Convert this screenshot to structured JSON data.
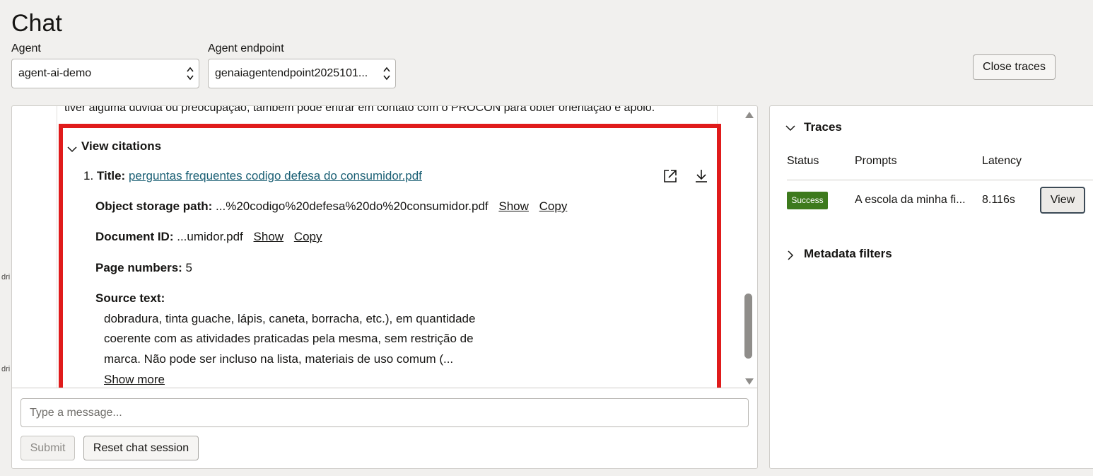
{
  "header": {
    "title": "Chat",
    "agent_label": "Agent",
    "agent_value": "agent-ai-demo",
    "endpoint_label": "Agent endpoint",
    "endpoint_value": "genaiagentendpoint2025101...",
    "close_traces_label": "Close traces"
  },
  "left_clip": [
    "dri",
    "dri"
  ],
  "chat": {
    "previous_text": "tiver alguma dúvida ou preocupação, também pode entrar em contato com o PROCON para obter orientação e apoio.",
    "citations": {
      "toggle_label": "View citations",
      "items": [
        {
          "index": "1.",
          "title_label": "Title:",
          "title_link": "perguntas frequentes codigo defesa do consumidor.pdf",
          "path_label": "Object storage path:",
          "path_value": "...%20codigo%20defesa%20do%20consumidor.pdf",
          "doc_id_label": "Document ID:",
          "doc_id_value": "...umidor.pdf",
          "show_label": "Show",
          "copy_label": "Copy",
          "page_label": "Page numbers:",
          "page_value": "5",
          "source_label": "Source text:",
          "source_lines": [
            "dobradura, tinta guache, lápis, caneta, borracha, etc.), em quantidade",
            "coerente com as atividades praticadas pela mesma, sem restrição de",
            "marca. Não pode ser incluso na lista, materiais de uso comum (..."
          ],
          "show_more_label": "Show more"
        }
      ]
    },
    "input_placeholder": "Type a message...",
    "submit_label": "Submit",
    "reset_label": "Reset chat session"
  },
  "traces": {
    "title": "Traces",
    "columns": [
      "Status",
      "Prompts",
      "Latency"
    ],
    "rows": [
      {
        "status": "Success",
        "prompt": "A escola da minha fi...",
        "latency": "8.116s",
        "action": "View"
      }
    ],
    "status_color": "#3d7a1d",
    "metadata_label": "Metadata filters"
  },
  "colors": {
    "highlight": "#e01b1b",
    "link": "#1a5f74"
  }
}
